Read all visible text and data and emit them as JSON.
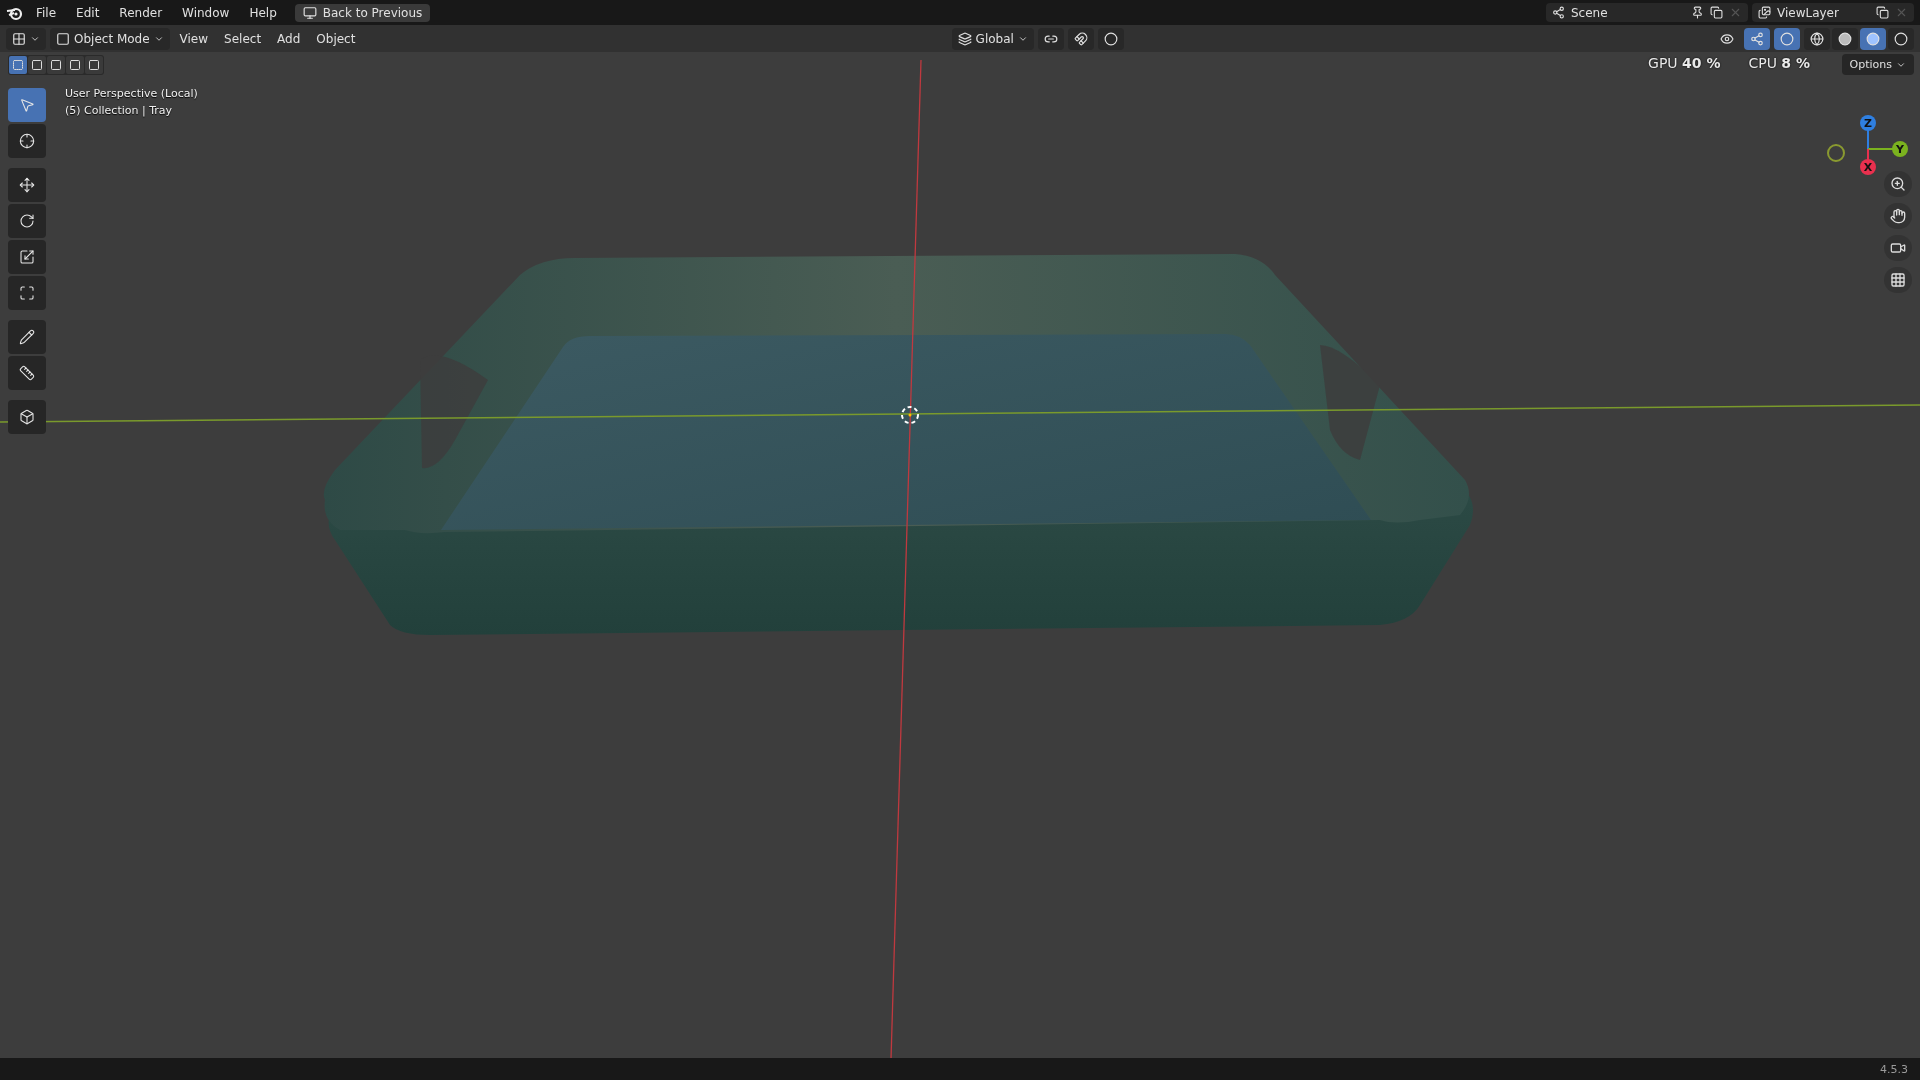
{
  "menu": [
    "File",
    "Edit",
    "Render",
    "Window",
    "Help"
  ],
  "back_button": "Back to Previous",
  "scene": "Scene",
  "view_layer": "ViewLayer",
  "perf": [
    {
      "label": "GPU",
      "value": "40 %"
    },
    {
      "label": "CPU",
      "value": "8 %"
    }
  ],
  "header": {
    "mode": "Object Mode",
    "menus": [
      "View",
      "Select",
      "Add",
      "Object"
    ],
    "orientation": "Global",
    "options": "Options"
  },
  "select_modes": [
    {
      "kind": "set",
      "selected": true
    },
    {
      "kind": "extend",
      "selected": false
    },
    {
      "kind": "subtract",
      "selected": false
    },
    {
      "kind": "invert",
      "selected": false
    },
    {
      "kind": "intersect",
      "selected": false
    }
  ],
  "tools": [
    {
      "kind": "select",
      "selected": true
    },
    {
      "kind": "cursor",
      "selected": false
    },
    {
      "kind": "move",
      "selected": false
    },
    {
      "kind": "rotate",
      "selected": false
    },
    {
      "kind": "scale",
      "selected": false
    },
    {
      "kind": "transform",
      "selected": false
    },
    {
      "kind": "annotate",
      "selected": false
    },
    {
      "kind": "measure",
      "selected": false
    },
    {
      "kind": "add-cube",
      "selected": false
    }
  ],
  "shading": [
    {
      "kind": "wireframe",
      "selected": false
    },
    {
      "kind": "solid",
      "selected": false
    },
    {
      "kind": "material",
      "selected": true
    },
    {
      "kind": "rendered",
      "selected": false
    }
  ],
  "viewport_info": [
    "User Perspective (Local)",
    "(5) Collection | Tray"
  ],
  "gizmo": [
    {
      "axis": "Z",
      "color": "#2f7fe0"
    },
    {
      "axis": "Y",
      "color": "#7bb21f"
    },
    {
      "axis": "X",
      "color": "#e8304e"
    }
  ],
  "version": "4.5.3"
}
